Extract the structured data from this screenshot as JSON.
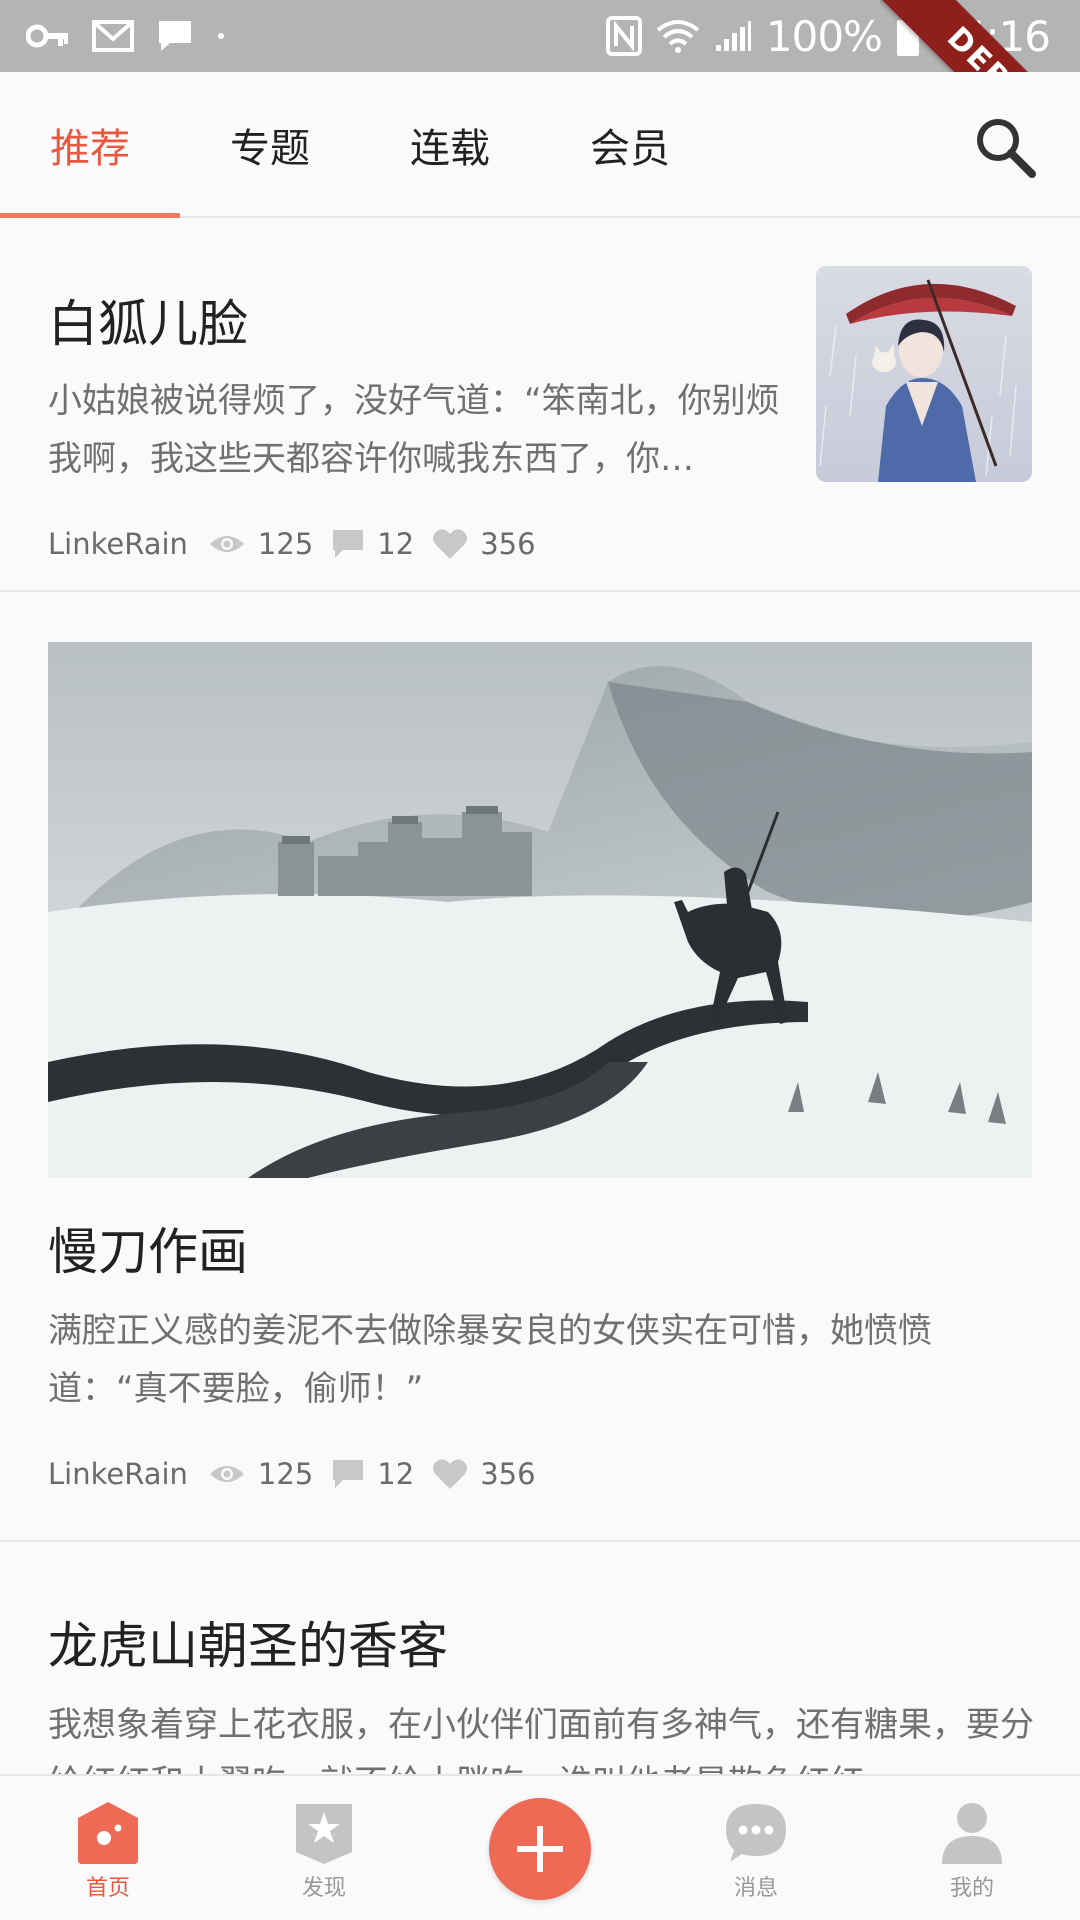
{
  "status_bar": {
    "battery": "100%",
    "time": "15:16",
    "debug_label": "DEBUG"
  },
  "tabs": [
    {
      "label": "推荐",
      "active": true
    },
    {
      "label": "专题",
      "active": false
    },
    {
      "label": "连载",
      "active": false
    },
    {
      "label": "会员",
      "active": false
    }
  ],
  "articles": [
    {
      "title": "白狐儿脸",
      "excerpt": "小姑娘被说得烦了，没好气道：“笨南北，你别烦我啊，我这些天都容许你喊我东西了，你…",
      "author": "LinkeRain",
      "views": "125",
      "comments": "12",
      "likes": "356"
    },
    {
      "title": "慢刀作画",
      "excerpt": "满腔正义感的姜泥不去做除暴安良的女侠实在可惜，她愤愤道：“真不要脸，偷师！”",
      "author": "LinkeRain",
      "views": "125",
      "comments": "12",
      "likes": "356"
    },
    {
      "title": "龙虎山朝圣的香客",
      "excerpt": "我想象着穿上花衣服，在小伙伴们面前有多神气，还有糖果，要分给红红和小翠吃，就不给小胖吃，谁叫他老是欺负红红"
    }
  ],
  "bottom_nav": [
    {
      "label": "首页",
      "icon": "home-icon",
      "active": true
    },
    {
      "label": "发现",
      "icon": "discover-star-icon",
      "active": false
    },
    {
      "label": "",
      "icon": "plus-icon",
      "active": false
    },
    {
      "label": "消息",
      "icon": "message-icon",
      "active": false
    },
    {
      "label": "我的",
      "icon": "profile-icon",
      "active": false
    }
  ],
  "colors": {
    "accent": "#e9573f",
    "status_bar": "#b4b4b4",
    "fab": "#ef6a55"
  }
}
